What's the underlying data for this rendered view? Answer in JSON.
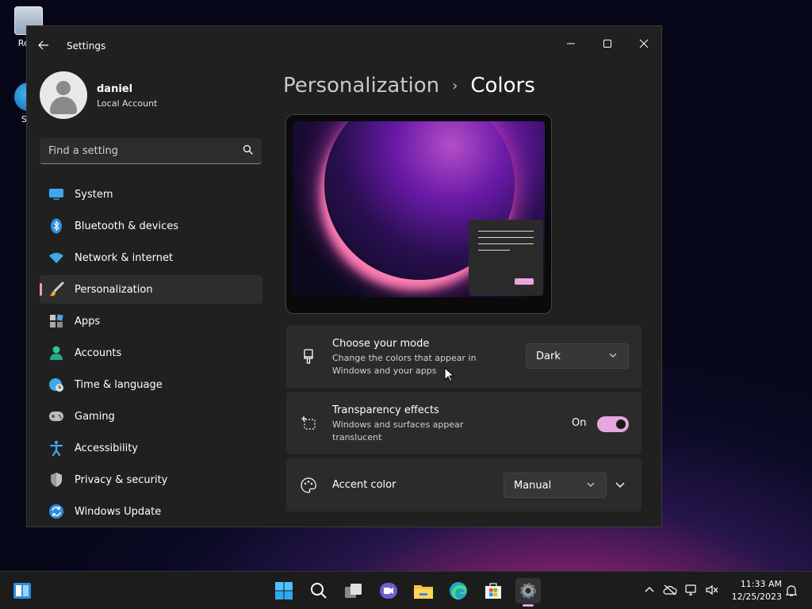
{
  "desktop": {
    "icons": [
      {
        "label": "Recy"
      },
      {
        "label": "SIU"
      }
    ]
  },
  "window": {
    "title": "Settings",
    "controls": {
      "minimize": "—",
      "maximize": "☐",
      "close": "✕"
    }
  },
  "profile": {
    "name": "daniel",
    "account_type": "Local Account"
  },
  "search": {
    "placeholder": "Find a setting"
  },
  "sidebar": {
    "items": [
      {
        "label": "System",
        "icon": "system-icon"
      },
      {
        "label": "Bluetooth & devices",
        "icon": "bluetooth-icon"
      },
      {
        "label": "Network & internet",
        "icon": "wifi-icon"
      },
      {
        "label": "Personalization",
        "icon": "brush-icon",
        "active": true
      },
      {
        "label": "Apps",
        "icon": "apps-icon"
      },
      {
        "label": "Accounts",
        "icon": "accounts-icon"
      },
      {
        "label": "Time & language",
        "icon": "time-language-icon"
      },
      {
        "label": "Gaming",
        "icon": "gaming-icon"
      },
      {
        "label": "Accessibility",
        "icon": "accessibility-icon"
      },
      {
        "label": "Privacy & security",
        "icon": "shield-icon"
      },
      {
        "label": "Windows Update",
        "icon": "update-icon"
      }
    ]
  },
  "breadcrumb": {
    "parent": "Personalization",
    "separator": "›",
    "current": "Colors"
  },
  "settings": {
    "mode": {
      "title": "Choose your mode",
      "description": "Change the colors that appear in Windows and your apps",
      "value": "Dark"
    },
    "transparency": {
      "title": "Transparency effects",
      "description": "Windows and surfaces appear translucent",
      "state_label": "On",
      "enabled": true
    },
    "accent": {
      "title": "Accent color",
      "value": "Manual"
    }
  },
  "taskbar": {
    "clock_time": "11:33 AM",
    "clock_date": "12/25/2023"
  },
  "colors": {
    "accent": "#e8a6df",
    "window_bg": "#202020",
    "card_bg": "#2b2b2b"
  }
}
